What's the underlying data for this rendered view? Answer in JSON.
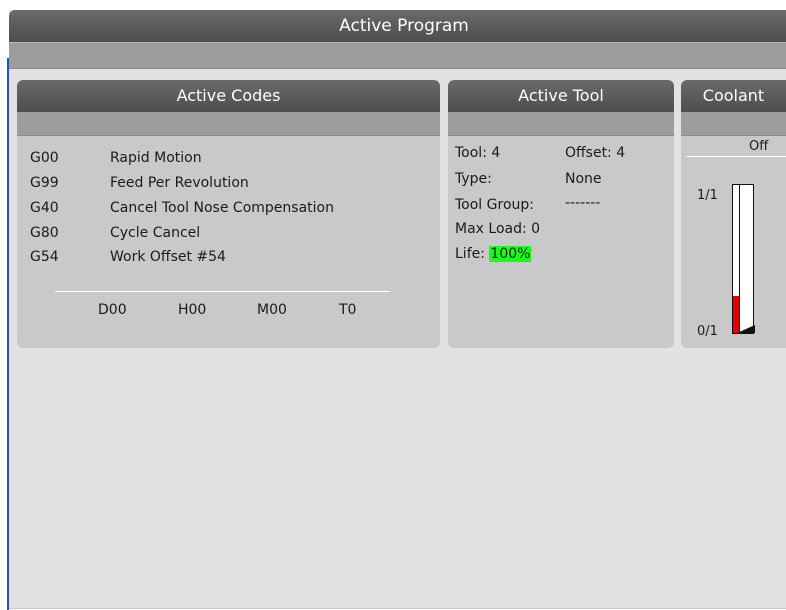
{
  "header": {
    "title": "Active Program"
  },
  "active_codes": {
    "title": "Active Codes",
    "codes": [
      {
        "code": "G00",
        "desc": "Rapid Motion"
      },
      {
        "code": "G99",
        "desc": "Feed Per Revolution"
      },
      {
        "code": "G40",
        "desc": "Cancel Tool Nose Compensation"
      },
      {
        "code": "G80",
        "desc": "Cycle Cancel"
      },
      {
        "code": "G54",
        "desc": "Work Offset #54"
      }
    ],
    "footer": [
      "D00",
      "H00",
      "M00",
      "T0"
    ]
  },
  "active_tool": {
    "title": "Active Tool",
    "tool_label": "Tool: 4",
    "offset_label": "Offset: 4",
    "type_label": "Type:",
    "type_value": "None",
    "group_label": "Tool Group:",
    "group_value": "-------",
    "max_load_label": "Max Load: 0",
    "life_label": "Life:",
    "life_value": "100%",
    "life_color": "#18ff18"
  },
  "coolant": {
    "title": "Coolant",
    "status": "Off",
    "scale_top": "1/1",
    "scale_bottom": "0/1",
    "level_fraction": 0.25,
    "level_color": "#e00000"
  }
}
